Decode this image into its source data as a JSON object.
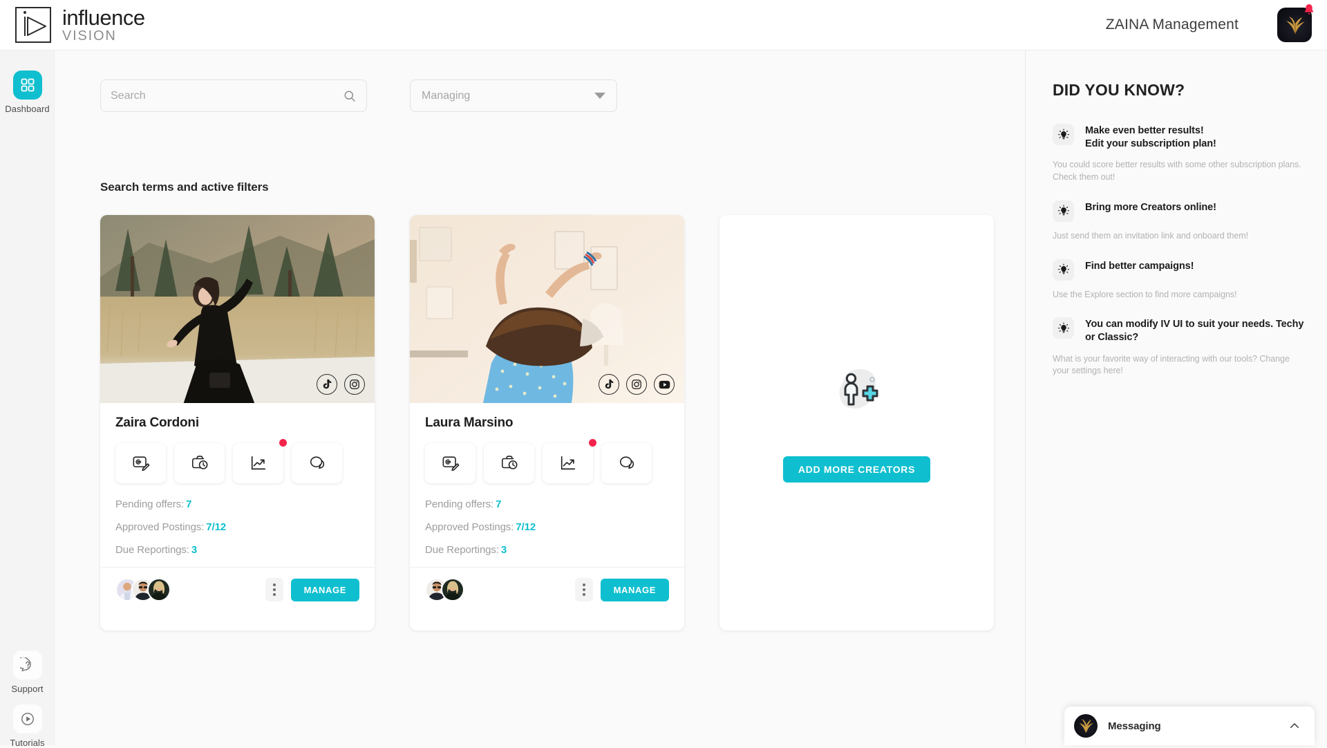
{
  "header": {
    "logo_primary": "influence",
    "logo_secondary": "VISION",
    "logo_mark_name": "play-in-frame-logo",
    "org_name": "ZAINA Management",
    "avatar_name": "phoenix-avatar",
    "notification_icon": "bell-icon"
  },
  "sidebar": {
    "items": [
      {
        "label": "Dashboard",
        "icon": "grid-icon",
        "active": true
      },
      {
        "label": "Support",
        "icon": "question-bubble-icon",
        "active": false
      },
      {
        "label": "Tutorials",
        "icon": "play-circle-icon",
        "active": false
      }
    ]
  },
  "toolbar": {
    "search_placeholder": "Search",
    "search_value": "",
    "search_icon": "search-icon",
    "filter_value": "Managing",
    "filter_options": [
      "Managing"
    ],
    "filter_icon": "chevron-down-icon",
    "filters_label": "Search terms and active filters"
  },
  "creators": [
    {
      "name": "Zaira Cordoni",
      "photo": "woman-black-dress-forest",
      "socials": [
        "tiktok-icon",
        "instagram-icon"
      ],
      "actions": [
        {
          "icon": "offer-edit-icon",
          "badge": false
        },
        {
          "icon": "briefcase-clock-icon",
          "badge": false
        },
        {
          "icon": "analytics-chart-icon",
          "badge": true
        },
        {
          "icon": "chat-bubbles-icon",
          "badge": false
        }
      ],
      "stats": [
        {
          "label": "Pending offers:",
          "value": "7"
        },
        {
          "label": "Approved  Postings:",
          "value": "7/12"
        },
        {
          "label": "Due Reportings:",
          "value": "3"
        }
      ],
      "avatar_count": 3,
      "more_icon": "kebab-menu-icon",
      "manage_label": "MANAGE"
    },
    {
      "name": "Laura Marsino",
      "photo": "woman-blue-dress-dancing",
      "socials": [
        "tiktok-icon",
        "instagram-icon",
        "youtube-icon"
      ],
      "actions": [
        {
          "icon": "offer-edit-icon",
          "badge": false
        },
        {
          "icon": "briefcase-clock-icon",
          "badge": false
        },
        {
          "icon": "analytics-chart-icon",
          "badge": true
        },
        {
          "icon": "chat-bubbles-icon",
          "badge": false
        }
      ],
      "stats": [
        {
          "label": "Pending offers:",
          "value": "7"
        },
        {
          "label": "Approved  Postings:",
          "value": "7/12"
        },
        {
          "label": "Due Reportings:",
          "value": "3"
        }
      ],
      "avatar_count": 2,
      "more_icon": "kebab-menu-icon",
      "manage_label": "MANAGE"
    }
  ],
  "add_card": {
    "illustration": "add-person-icon",
    "button_label": "ADD MORE CREATORS"
  },
  "did_you_know": {
    "title": "DID YOU KNOW?",
    "tips": [
      {
        "icon": "lightbulb-icon",
        "title": "Make even better results!\nEdit your subscription plan!",
        "body": "You could score better results with some other subscription plans. Check them out!"
      },
      {
        "icon": "lightbulb-icon",
        "title": "Bring more Creators online!",
        "body": "Just send them an invitation link and onboard them!"
      },
      {
        "icon": "lightbulb-icon",
        "title": "Find better campaigns!",
        "body": "Use the Explore section to find more campaigns!"
      },
      {
        "icon": "lightbulb-icon",
        "title": "You can modify IV UI to suit your needs. Techy or Classic?",
        "body": "What is your favorite way of interacting with our tools? Change your settings here!"
      }
    ]
  },
  "messaging_dock": {
    "label": "Messaging",
    "avatar": "phoenix-avatar",
    "toggle_icon": "chevron-up-icon"
  },
  "colors": {
    "accent": "#0FBFCF",
    "badge": "#f3244b",
    "page_bg": "#fafafa",
    "rail_bg": "#f4f4f4",
    "muted_text": "#a8a8a8"
  }
}
